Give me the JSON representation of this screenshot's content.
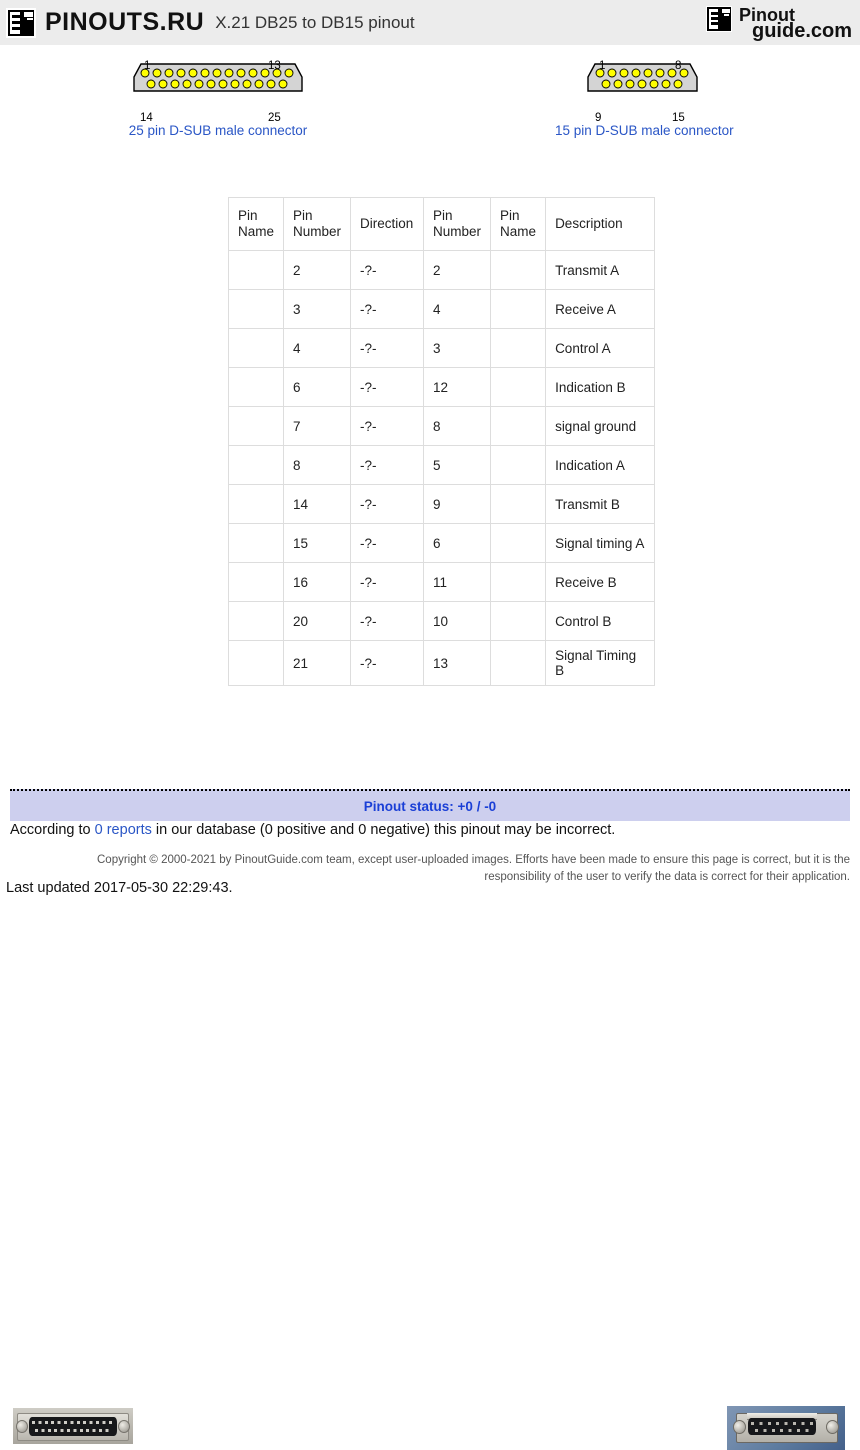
{
  "header": {
    "brand_name": "PINOUTS.RU",
    "page_title": "X.21 DB25 to DB15 pinout",
    "right_brand_top": "Pinout",
    "right_brand_bottom": "guide.com",
    "logo_icon": "pinout-logo-icon"
  },
  "connectors": [
    {
      "id": "db25",
      "caption": "25 pin D-SUB male connector",
      "pin_count": 25,
      "top_row_pins": 13,
      "bottom_row_pins": 12,
      "corner_labels": {
        "top_left": "1",
        "top_right": "13",
        "bottom_left": "14",
        "bottom_right": "25"
      },
      "body_color": "#d4d4d4",
      "pin_color": "#ffff00"
    },
    {
      "id": "db15",
      "caption": "15 pin D-SUB male connector",
      "pin_count": 15,
      "top_row_pins": 8,
      "bottom_row_pins": 7,
      "corner_labels": {
        "top_left": "1",
        "top_right": "8",
        "bottom_left": "9",
        "bottom_right": "15"
      },
      "body_color": "#d4d4d4",
      "pin_color": "#ffff00"
    }
  ],
  "table": {
    "headers": [
      "Pin Name",
      "Pin Number",
      "Direction",
      "Pin Number",
      "Pin Name",
      "Description"
    ],
    "rows": [
      {
        "pin_name_a": "",
        "pin_number_a": "2",
        "direction": "-?-",
        "pin_number_b": "2",
        "pin_name_b": "",
        "description": "Transmit A"
      },
      {
        "pin_name_a": "",
        "pin_number_a": "3",
        "direction": "-?-",
        "pin_number_b": "4",
        "pin_name_b": "",
        "description": "Receive A"
      },
      {
        "pin_name_a": "",
        "pin_number_a": "4",
        "direction": "-?-",
        "pin_number_b": "3",
        "pin_name_b": "",
        "description": "Control A"
      },
      {
        "pin_name_a": "",
        "pin_number_a": "6",
        "direction": "-?-",
        "pin_number_b": "12",
        "pin_name_b": "",
        "description": "Indication B"
      },
      {
        "pin_name_a": "",
        "pin_number_a": "7",
        "direction": "-?-",
        "pin_number_b": "8",
        "pin_name_b": "",
        "description": "signal ground"
      },
      {
        "pin_name_a": "",
        "pin_number_a": "8",
        "direction": "-?-",
        "pin_number_b": "5",
        "pin_name_b": "",
        "description": "Indication A"
      },
      {
        "pin_name_a": "",
        "pin_number_a": "14",
        "direction": "-?-",
        "pin_number_b": "9",
        "pin_name_b": "",
        "description": "Transmit B"
      },
      {
        "pin_name_a": "",
        "pin_number_a": "15",
        "direction": "-?-",
        "pin_number_b": "6",
        "pin_name_b": "",
        "description": "Signal timing A"
      },
      {
        "pin_name_a": "",
        "pin_number_a": "16",
        "direction": "-?-",
        "pin_number_b": "11",
        "pin_name_b": "",
        "description": "Receive B"
      },
      {
        "pin_name_a": "",
        "pin_number_a": "20",
        "direction": "-?-",
        "pin_number_b": "10",
        "pin_name_b": "",
        "description": "Control B"
      },
      {
        "pin_name_a": "",
        "pin_number_a": "21",
        "direction": "-?-",
        "pin_number_b": "13",
        "pin_name_b": "",
        "description": "Signal Timing B"
      }
    ]
  },
  "photos": {
    "left_alt": "db25-male-connector-photo",
    "right_alt": "db15-male-connector-photo"
  },
  "status": {
    "label": "Pinout status: +0 / -0",
    "report_prefix": "According to ",
    "report_link": "0 reports",
    "report_suffix": " in our database (0 positive and 0 negative) this pinout may be incorrect.",
    "bar_color": "#cdcfee",
    "link_color": "#2a56c6"
  },
  "footer": {
    "copyright": "Copyright © 2000-2021 by PinoutGuide.com team, except user-uploaded images. Efforts have been made to ensure this page is correct, but it is the responsibility of the user to verify the data is correct for their application.",
    "last_updated": "Last updated 2017-05-30 22:29:43."
  }
}
